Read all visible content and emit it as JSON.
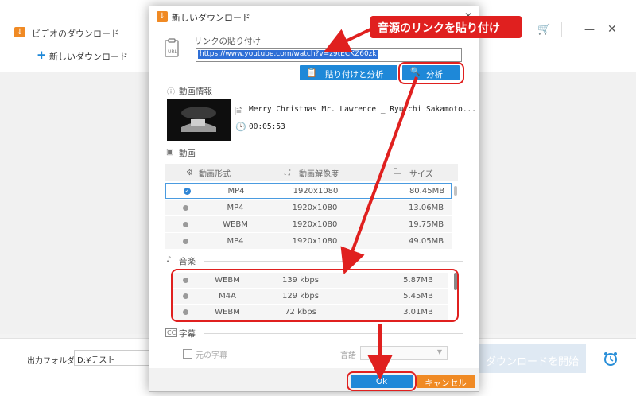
{
  "main": {
    "title": "ビデオのダウンロード",
    "new_download": "新しいダウンロード",
    "output_folder_label": "出力フォルダ：",
    "output_folder_value": "D:¥テスト",
    "start_download": "ダウンロードを開始"
  },
  "dialog": {
    "title": "新しいダウンロード",
    "link_label": "リンクの貼り付け",
    "url": "https://www.youtube.com/watch?v=z9tECKZ60zk",
    "paste_analyze": "貼り付けと分析",
    "analyze": "分析",
    "video_info_label": "動画情報",
    "video_title": "Merry Christmas Mr. Lawrence _ Ryuichi Sakamoto...",
    "duration": "00:05:53",
    "video_section": "動画",
    "columns": {
      "format": "動画形式",
      "resolution": "動画解像度",
      "size": "サイズ"
    },
    "video_rows": [
      {
        "format": "MP4",
        "resolution": "1920x1080",
        "size": "80.45MB",
        "selected": true
      },
      {
        "format": "MP4",
        "resolution": "1920x1080",
        "size": "13.06MB",
        "selected": false
      },
      {
        "format": "WEBM",
        "resolution": "1920x1080",
        "size": "19.75MB",
        "selected": false
      },
      {
        "format": "MP4",
        "resolution": "1920x1080",
        "size": "49.05MB",
        "selected": false
      }
    ],
    "audio_section": "音楽",
    "audio_rows": [
      {
        "format": "WEBM",
        "bitrate": "139 kbps",
        "size": "5.87MB"
      },
      {
        "format": "M4A",
        "bitrate": "129 kbps",
        "size": "5.45MB"
      },
      {
        "format": "WEBM",
        "bitrate": "72 kbps",
        "size": "3.01MB"
      }
    ],
    "subtitle_section": "字幕",
    "original_subtitle": "元の字幕",
    "language_label": "言語",
    "ok": "Ok",
    "cancel": "キャンセル"
  },
  "annotation": {
    "text": "音源のリンクを貼り付け"
  },
  "colors": {
    "accent_blue": "#1e88d8",
    "accent_orange": "#f08a24",
    "annotation_red": "#e0201f"
  }
}
